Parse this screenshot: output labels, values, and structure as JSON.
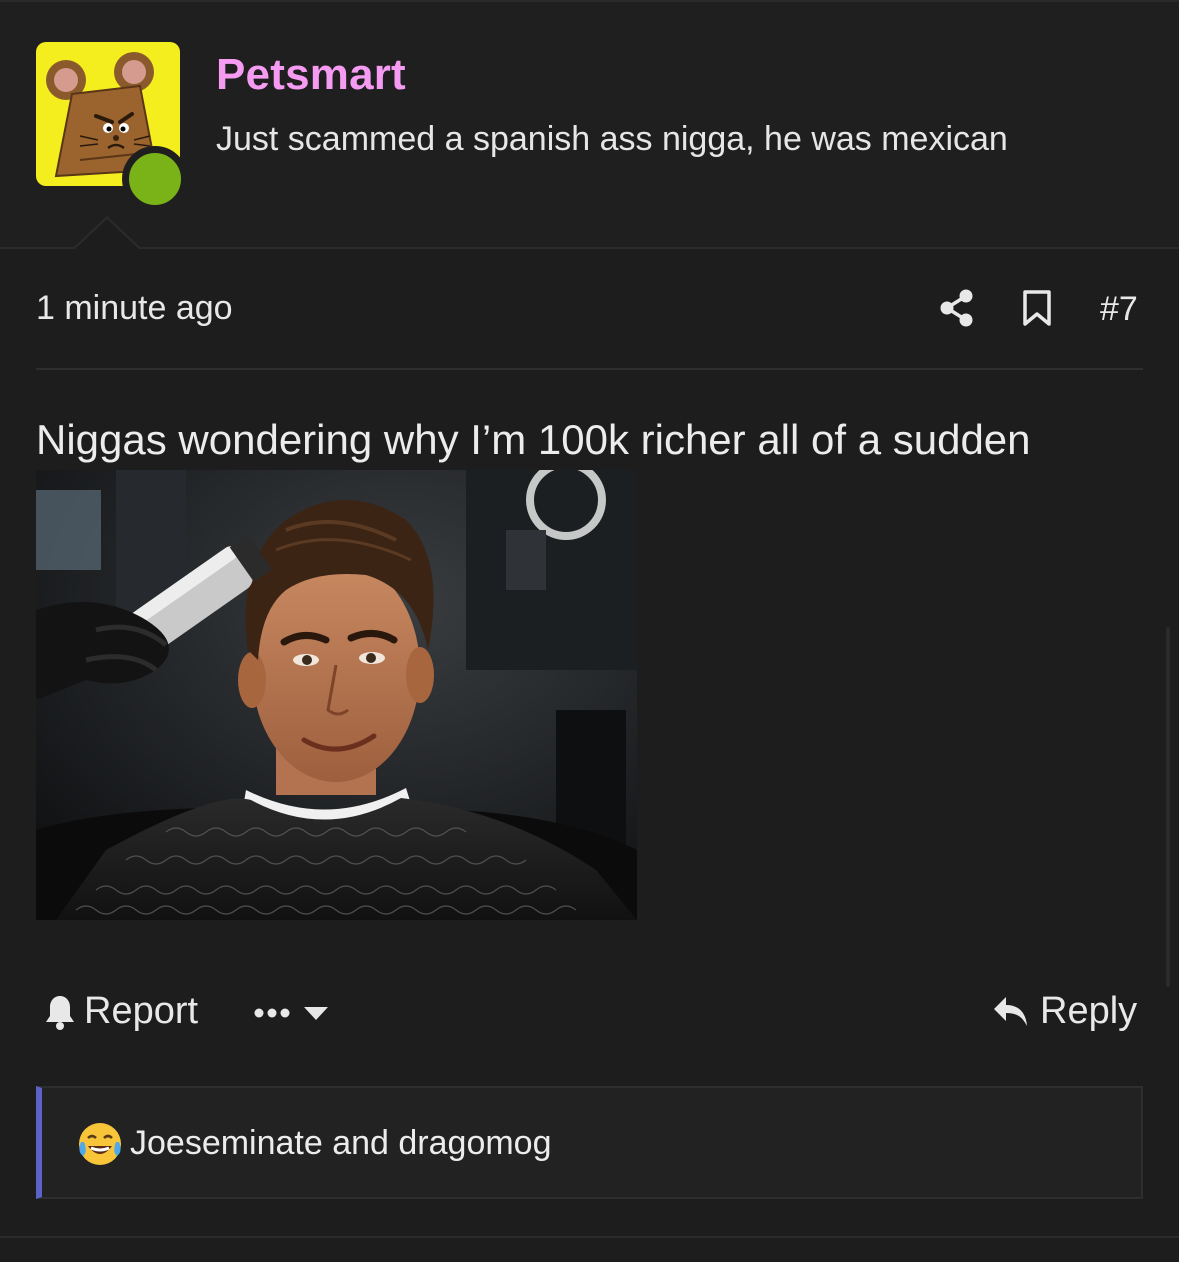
{
  "post": {
    "author": {
      "username": "Petsmart",
      "user_title": "Just scammed a spanish ass nigga, he was mexican",
      "avatar_icon": "angry-mouse-avatar",
      "online_status": "online"
    },
    "meta": {
      "timestamp": "1 minute ago",
      "post_number": "#7"
    },
    "body": {
      "text": "Niggas wondering why I’m 100k richer all of a sudden"
    },
    "actions": {
      "report_label": "Report",
      "more_icon": "ellipsis-icon",
      "reply_label": "Reply"
    },
    "reactions": {
      "emoji": "joy-tears",
      "text": "Joeseminate and dragomog"
    }
  },
  "colors": {
    "background": "#1d1d1d",
    "username": "#f59bf2",
    "avatar_bg": "#f5ee1f",
    "online": "#7ab317",
    "reaction_accent": "#5b63c9"
  }
}
